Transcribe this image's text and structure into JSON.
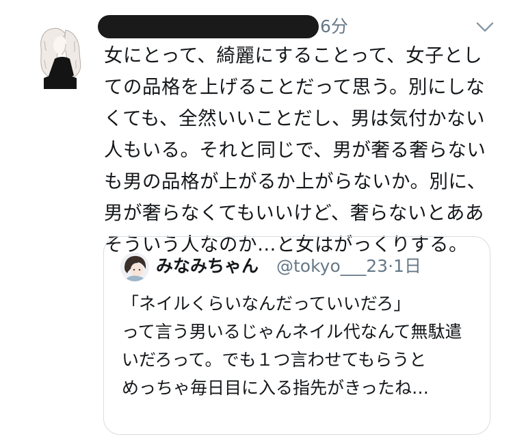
{
  "tweet": {
    "timestamp": "6分",
    "text": "女にとって、綺麗にすることって、女子としての品格を上げることだって思う。別にしなくても、全然いいことだし、男は気付かない人もいる。それと同じで、男が奢る奢らないも男の品格が上がるか上がらないか。別に、男が奢らなくてもいいけど、奢らないとああそういう人なのか…と女はがっくりする。",
    "menu_icon": "chevron-down-icon"
  },
  "quoted": {
    "display_name": "みなみちゃん",
    "handle": "@tokyo___23",
    "separator": "·",
    "time": "1日",
    "text": "「ネイルくらいなんだっていいだろ」\nって言う男いるじゃんネイル代なんて無駄遣いだろって。でも１つ言わせてもらうと\nめっちゃ毎日目に入る指先がきったね…"
  },
  "colors": {
    "text": "#14171a",
    "secondary": "#657786",
    "border": "#d7dde2",
    "redaction": "#1a1a1a"
  }
}
